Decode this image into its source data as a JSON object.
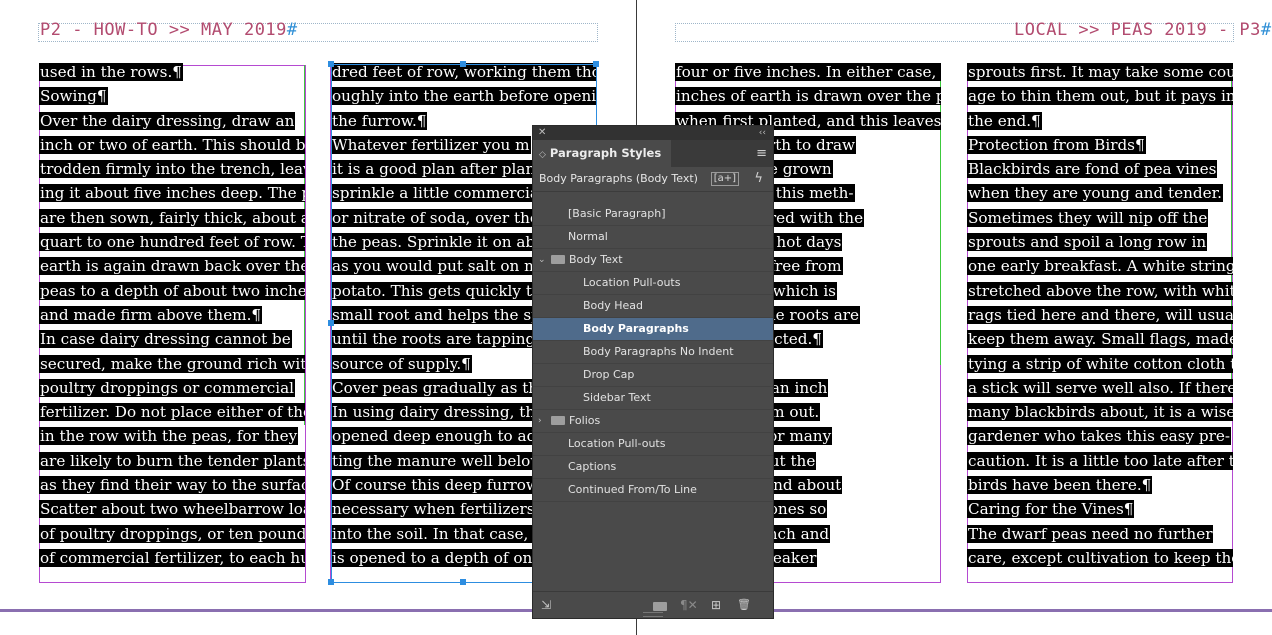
{
  "folios": {
    "left": "P2 - HOW-TO >> MAY 2019",
    "left_mark": "#",
    "right": "LOCAL >> PEAS 2019 - P3",
    "right_mark": "#"
  },
  "columns": {
    "col1": [
      "used in the rows.¶",
      "    Sowing¶",
      "    Over the dairy dressing, draw an",
      "inch or two of earth. This should be",
      "trodden firmly into the trench, leav-",
      "ing it about five inches deep. The peas",
      "are then sown, fairly thick, about a",
      "quart to one hundred feet of row. The",
      "earth is again drawn back over the",
      "peas to a depth of about two inches,",
      "and made firm above them.¶",
      "    In case dairy dressing cannot be",
      "secured, make the ground rich with",
      "poultry droppings or commercial",
      "fertilizer. Do not place either of these",
      "in the row with the peas, for they",
      "are likely to burn the tender plants",
      "as they find their way to the surface.",
      "Scatter about two wheelbarrow loads",
      "of poultry droppings, or ten pounds",
      "of commercial fertilizer, to each hun-"
    ],
    "col2": [
      "dred feet of row, working them thor-",
      "oughly into the earth before opening",
      "the furrow.¶",
      "    Whatever fertilizer you m",
      "it is a good plan after plantin",
      "sprinkle a little commercial f",
      "or nitrate of soda, over the ro",
      "the peas. Sprinkle it on abou",
      "as you would put salt on mas",
      "potato. This gets quickly to th",
      "small root and helps the spro",
      "until the roots are tapping th",
      "source of supply.¶",
      "    Cover peas gradually as th",
      "In using dairy dressing, the f",
      "opened deep enough to adm",
      "ting the manure well below t",
      "Of course this deep furrow is",
      "necessary when fertilizers ar",
      "into the soil. In that case, the",
      "is opened to a depth of only a"
    ],
    "col3": [
      "four or five inches. In either case, two",
      "inches of earth is drawn over the peas",
      "when first planted, and this leaves",
      "    or two of earth to draw",
      "    ter they have grown",
      "    nes high. By this meth-",
      "    re well covered with the",
      "    nd when the hot days",
      "    ep cool and free from",
      "    the hot sun, which is",
      "    he vines if the roots are",
      "    ed and protected.¶",
      "    Out¶",
      "    peas are up an inch",
      "    e to thin them out.",
      "    esponsible for many",
      "    peas. Thin out the",
      "    that they stand about",
      "    and the tall ones so",
      "    d about an inch and",
      "    ull out the weaker"
    ],
    "col4": [
      "sprouts first. It may take some cour-",
      "age to thin them out, but it pays in",
      "the end.¶",
      "    Protection from Birds¶",
      "    Blackbirds are fond of pea vines",
      "when they are young and tender.",
      "Sometimes they will nip off the",
      "sprouts and spoil a long row in",
      "one early breakfast. A white string,",
      "stretched above the row, with white",
      "rags tied here and there, will usually",
      "keep them away. Small flags, made by",
      "tying a strip of white cotton cloth to",
      "a stick will serve well also. If there are",
      "many blackbirds about, it is a wise",
      "gardener who takes this easy pre-",
      "caution. It is a little too late after the",
      "birds have been there.¶",
      "    Caring for the Vines¶",
      "    The dwarf peas need no further",
      "care, except cultivation to keep the"
    ]
  },
  "panel": {
    "close_glyph": "✕",
    "collapse_glyph": "‹‹",
    "title": "Paragraph Styles",
    "tab_chevron": "◇",
    "menu_glyph": "≡",
    "current_style": "Body Paragraphs (Body Text)",
    "new_style_glyph": "[a+]",
    "quick_apply_glyph": "ϟ",
    "styles": [
      {
        "label": "[Basic Paragraph]",
        "indent": 1,
        "selected": false
      },
      {
        "label": "Normal",
        "indent": 1,
        "selected": false
      },
      {
        "label": "Body Text",
        "indent": 1,
        "selected": false,
        "group": true,
        "expanded": true
      },
      {
        "label": "Location Pull-outs",
        "indent": 2,
        "selected": false
      },
      {
        "label": "Body Head",
        "indent": 2,
        "selected": false
      },
      {
        "label": "Body Paragraphs",
        "indent": 2,
        "selected": true
      },
      {
        "label": "Body Paragraphs No Indent",
        "indent": 2,
        "selected": false
      },
      {
        "label": "Drop Cap",
        "indent": 2,
        "selected": false
      },
      {
        "label": "Sidebar Text",
        "indent": 2,
        "selected": false
      },
      {
        "label": "Folios",
        "indent": 1,
        "selected": false,
        "group": true,
        "expanded": false
      },
      {
        "label": "Location Pull-outs",
        "indent": 1,
        "selected": false
      },
      {
        "label": "Captions",
        "indent": 1,
        "selected": false
      },
      {
        "label": "Continued From/To Line",
        "indent": 1,
        "selected": false
      }
    ],
    "expanded_glyph": "⌄",
    "collapsed_glyph": "›",
    "footer": {
      "load_glyph": "⇲",
      "folder_glyph": "▬",
      "clear_glyph": "¶✕",
      "new_glyph": "⊞",
      "trash_glyph": "🗑"
    }
  }
}
